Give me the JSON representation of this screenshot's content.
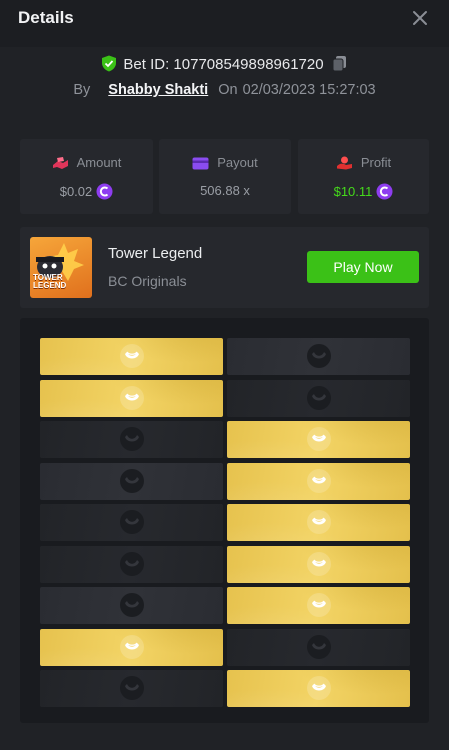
{
  "header": {
    "title": "Details"
  },
  "bet": {
    "id_label": "Bet ID: 107708549898961720",
    "by_label": "By",
    "user": "Shabby Shakti",
    "on_label": "On",
    "datetime": "02/03/2023 15:27:03"
  },
  "stats": {
    "amount": {
      "label": "Amount",
      "value": "$0.02"
    },
    "payout": {
      "label": "Payout",
      "value": "506.88 x"
    },
    "profit": {
      "label": "Profit",
      "value": "$10.11"
    }
  },
  "game": {
    "name": "Tower Legend",
    "provider": "BC Originals",
    "thumb_text": "TOWER\nLEGEND",
    "play_label": "Play Now"
  },
  "colors": {
    "accent_green": "#3bc117",
    "coin_purple": "#8e3df0",
    "tile_gold": "#efcf5e",
    "profit_green": "#45d91b"
  },
  "board": {
    "rows": [
      [
        "gold",
        "dark"
      ],
      [
        "gold",
        "darker"
      ],
      [
        "darker",
        "gold"
      ],
      [
        "dark",
        "gold"
      ],
      [
        "darker",
        "gold"
      ],
      [
        "darker",
        "gold"
      ],
      [
        "dark",
        "gold"
      ],
      [
        "gold",
        "darker"
      ],
      [
        "darker",
        "gold"
      ]
    ]
  }
}
